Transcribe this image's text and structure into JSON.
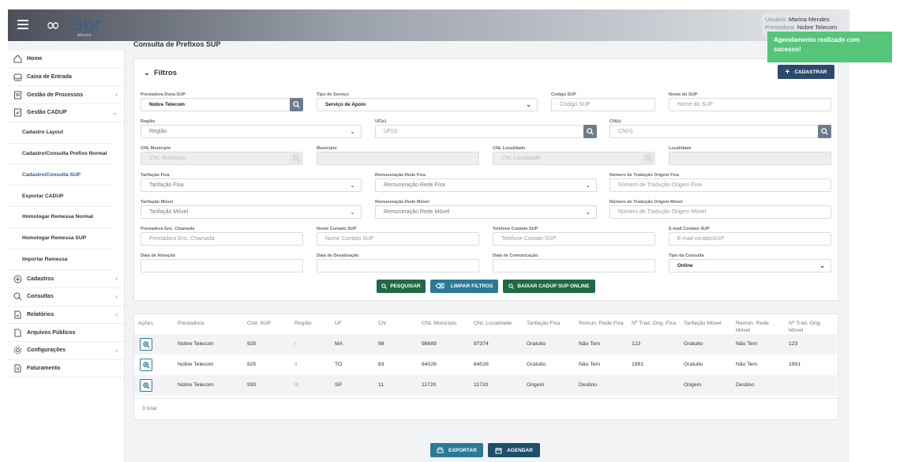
{
  "header": {
    "logo_text": "abr",
    "logo_sub": "telecom",
    "user_label": "Usuário:",
    "user_name": "Marina Mendes",
    "provider_label": "Prestadora:",
    "provider_name": "Nobre Telecom"
  },
  "toast": {
    "message": "Agendamento realizado com sucesso!"
  },
  "sidebar": {
    "items": [
      {
        "label": "Home",
        "icon": "home-icon"
      },
      {
        "label": "Caixa de Entrada",
        "icon": "inbox-icon"
      },
      {
        "label": "Gestão de Processos",
        "icon": "process-icon"
      },
      {
        "label": "Gestão CADUP",
        "icon": "cadup-icon"
      }
    ],
    "subitems": [
      {
        "label": "Cadastro Layout"
      },
      {
        "label": "Cadastro/Consulta Prefixo Normal"
      },
      {
        "label": "Cadastro/Consulta SUP"
      },
      {
        "label": "Exportar CADUP"
      },
      {
        "label": "Homologar Remessa Normal"
      },
      {
        "label": "Homologar Remessa SUP"
      },
      {
        "label": "Importar Remessa"
      }
    ],
    "bottom_items": [
      {
        "label": "Cadastros",
        "icon": "plus-circle-icon"
      },
      {
        "label": "Consultas",
        "icon": "search-icon"
      },
      {
        "label": "Relatórios",
        "icon": "report-icon"
      },
      {
        "label": "Arquivos Públicos",
        "icon": "file-icon"
      },
      {
        "label": "Configurações",
        "icon": "gear-icon"
      },
      {
        "label": "Faturamento",
        "icon": "billing-icon"
      }
    ]
  },
  "page": {
    "title": "Consulta de Prefixos SUP"
  },
  "filters": {
    "title": "Filtros",
    "cadastrar_label": "CADASTRAR",
    "fields": {
      "prestadora_dona": {
        "label": "Prestadora Dona SUP",
        "value": "Nobre Telecom"
      },
      "tipo_servico": {
        "label": "Tipo de Serviço",
        "value": "Serviço de Apoio"
      },
      "codigo_sup": {
        "label": "Código SUP",
        "placeholder": "Código SUP"
      },
      "nome_sup": {
        "label": "Nome do SUP",
        "placeholder": "Nome do SUP"
      },
      "regiao": {
        "label": "Região",
        "placeholder": "Região"
      },
      "ufs": {
        "label": "UF(s)",
        "placeholder": "UF(s)"
      },
      "cns": {
        "label": "CN(s)",
        "placeholder": "CN(s)"
      },
      "cnl_municipio": {
        "label": "CNL Município",
        "placeholder": "CNL Município"
      },
      "municipio": {
        "label": "Município",
        "placeholder": ""
      },
      "cnl_localidade": {
        "label": "CNL Localidade",
        "placeholder": "CNL Localidade"
      },
      "localidade": {
        "label": "Localidade",
        "placeholder": ""
      },
      "tarifacao_fixa": {
        "label": "Tarifação Fixa",
        "placeholder": "Tarifação Fixa"
      },
      "remuneracao_fixa": {
        "label": "Remuneração Rede Fixa",
        "placeholder": "Remuneração Rede Fixa"
      },
      "num_trad_fixa": {
        "label": "Número de Tradução Origem Fixa",
        "placeholder": "Número de Tradução Origem Fixa"
      },
      "tarifacao_movel": {
        "label": "Tarifação Móvel",
        "placeholder": "Tarifação Móvel"
      },
      "remuneracao_movel": {
        "label": "Remuneração Rede Móvel",
        "placeholder": "Remuneração Rede Móvel"
      },
      "num_trad_movel": {
        "label": "Número de Tradução Origem Móvel",
        "placeholder": "Número de Tradução Origem Móvel"
      },
      "prestadora_enc": {
        "label": "Prestadora Enc. Chamada",
        "placeholder": "Prestadora Enc. Chamada"
      },
      "nome_contato": {
        "label": "Nome Contato SUP",
        "placeholder": "Nome Contato SUP"
      },
      "telefone_contato": {
        "label": "Telefone Contato SUP",
        "placeholder": "Telefone Contato SUP"
      },
      "email_contato": {
        "label": "E-mail Contato SUP",
        "placeholder": "E-mail contatoSUP"
      },
      "data_ativacao": {
        "label": "Data de Ativação",
        "placeholder": ""
      },
      "data_desativacao": {
        "label": "Data de Desativação",
        "placeholder": ""
      },
      "data_comunicacao": {
        "label": "Data de Comunicação",
        "placeholder": ""
      },
      "tipo_consulta": {
        "label": "Tipo da Consulta",
        "value": "Online"
      }
    },
    "buttons": {
      "pesquisar": "PESQUISAR",
      "limpar": "LIMPAR FILTROS",
      "baixar": "BAIXAR CADUP SUP ONLINE"
    }
  },
  "table": {
    "headers": [
      "Ações",
      "Prestadora",
      "Cód. SUP",
      "Região",
      "UF",
      "CN",
      "CNL Município",
      "CNL Localidade",
      "Tarifação Fixa",
      "Remun. Rede Fixa",
      "Nº Trad. Orig. Fixa",
      "Tarifação Móvel",
      "Remun. Rede Móvel",
      "Nº Trad. Orig. Móvel"
    ],
    "rows": [
      [
        "",
        "Nobre Telecom",
        "925",
        "I",
        "MA",
        "98",
        "98689",
        "97374",
        "Gratuito",
        "Não Tem",
        "123",
        "Gratuito",
        "Não Tem",
        "123"
      ],
      [
        "",
        "Nobre Telecom",
        "925",
        "II",
        "TO",
        "63",
        "64026",
        "64026",
        "Gratuito",
        "Não Tem",
        "1991",
        "Gratuito",
        "Não Tem",
        "1991"
      ],
      [
        "",
        "Nobre Telecom",
        "930",
        "III",
        "SP",
        "11",
        "11720",
        "11720",
        "Origem",
        "Destino",
        "",
        "Origem",
        "Destino",
        ""
      ]
    ],
    "total": "3 total"
  },
  "footer_buttons": {
    "exportar": "EXPORTAR",
    "agendar": "AGENDAR"
  }
}
